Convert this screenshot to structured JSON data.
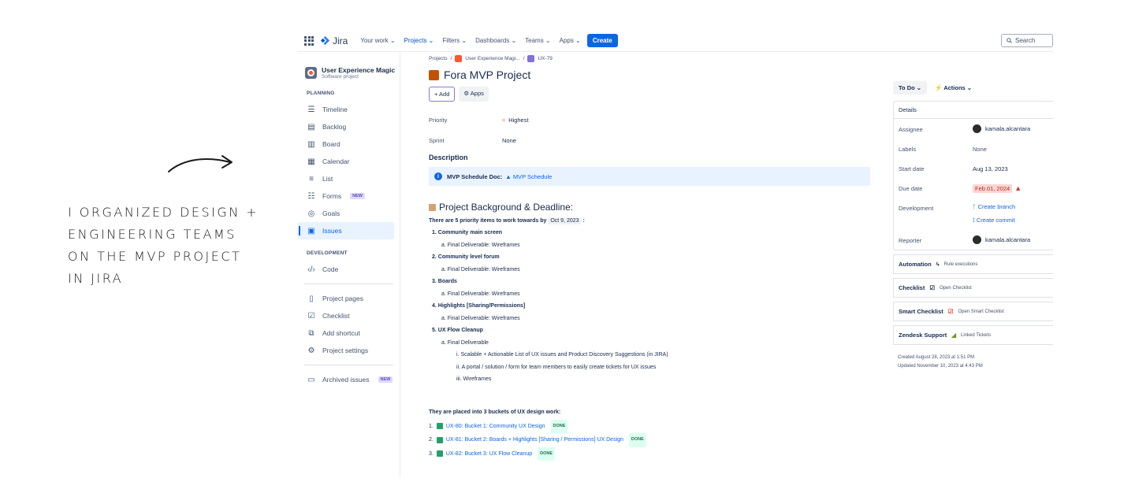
{
  "annotation": {
    "lines": [
      "I ORGANIZED DESIGN +",
      "ENGINEERING TEAMS",
      "ON THE MVP PROJECT",
      "IN JIRA"
    ]
  },
  "topnav": {
    "logo": "Jira",
    "items": [
      "Your work ⌄",
      "Projects ⌄",
      "Filters ⌄",
      "Dashboards ⌄",
      "Teams ⌄",
      "Apps ⌄"
    ],
    "create": "Create",
    "search_placeholder": "Search"
  },
  "sidebar": {
    "project_name": "User Experience Magic",
    "project_type": "Software project",
    "planning_label": "PLANNING",
    "planning": [
      {
        "label": "Timeline",
        "icon": "timeline-icon"
      },
      {
        "label": "Backlog",
        "icon": "backlog-icon"
      },
      {
        "label": "Board",
        "icon": "board-icon"
      },
      {
        "label": "Calendar",
        "icon": "calendar-icon"
      },
      {
        "label": "List",
        "icon": "list-icon"
      },
      {
        "label": "Forms",
        "icon": "forms-icon",
        "badge": "NEW"
      },
      {
        "label": "Goals",
        "icon": "goals-icon"
      },
      {
        "label": "Issues",
        "icon": "issues-icon"
      }
    ],
    "development_label": "DEVELOPMENT",
    "code": "Code",
    "project_pages": "Project pages",
    "checklist": "Checklist",
    "add_shortcut": "Add shortcut",
    "project_settings": "Project settings",
    "archived": "Archived issues",
    "archived_badge": "NEW"
  },
  "breadcrumb": {
    "projects": "Projects",
    "sep": "/",
    "project": "User Experience Magi...",
    "issue": "UX-79"
  },
  "issue": {
    "title": "Fora MVP Project",
    "add": "+ Add",
    "apps": "⚙ Apps",
    "priority_label": "Priority",
    "priority_value": "Highest",
    "sprint_label": "Sprint",
    "sprint_value": "None",
    "description_label": "Description",
    "panel_label": "MVP Schedule Doc:",
    "panel_link": "MVP Schedule",
    "bg_heading": "Project Background & Deadline:",
    "intro": "There are 5 priority items to work towards by",
    "intro_date": "Oct 9, 2023",
    "intro_end": ":",
    "items": [
      "1. Community main screen",
      "a. Final Deliverable: Wireframes",
      "2. Community level forum",
      "a. Final Deliverable: Wireframes",
      "3. Boards",
      "a. Final Deliverable: Wireframes",
      "4. Highlights [Sharing/Permissions]",
      "a. Final Deliverable: Wireframes",
      "5. UX Flow Cleanup",
      "a. Final Deliverable",
      "i. Scalable + Actionable List of UX issues and Product Discovery Suggestions (in JIRA)",
      "ii. A portal / solution / form for team members to easily create tickets for UX issues",
      "iii. Wireframes"
    ],
    "buckets_heading": "They are placed into 3 buckets of UX design work:",
    "buckets": [
      {
        "num": "1.",
        "link": "UX-80: Bucket 1: Community UX Design",
        "status": "DONE"
      },
      {
        "num": "2.",
        "link": "UX-81: Bucket 2: Boards + Highlights [Sharing / Permissions] UX Design",
        "status": "DONE"
      },
      {
        "num": "3.",
        "link": "UX-82: Bucket 3: UX Flow Cleanup",
        "status": "DONE"
      }
    ]
  },
  "details": {
    "status": "To Do ⌄",
    "actions": "Actions ⌄",
    "header": "Details",
    "assignee_label": "Assignee",
    "assignee": "kamala.alcantara",
    "labels_label": "Labels",
    "labels": "None",
    "start_label": "Start date",
    "start": "Aug 13, 2023",
    "due_label": "Due date",
    "due": "Feb 01, 2024",
    "dev_label": "Development",
    "create_branch": "Create branch",
    "create_commit": "Create commit",
    "reporter_label": "Reporter",
    "reporter": "kamala.alcantara",
    "automation": "Automation",
    "automation_sub": "Rule executions",
    "checklist": "Checklist",
    "checklist_sub": "Open Checklist",
    "smart": "Smart Checklist",
    "smart_sub": "Open Smart Checklist",
    "zendesk": "Zendesk Support",
    "zendesk_sub": "Linked Tickets",
    "created": "Created August 28, 2023 at 1:51 PM",
    "updated": "Updated November 10, 2023 at 4:43 PM"
  },
  "colors": {
    "accent": "#0c66e4",
    "done": "#216e4e",
    "danger": "#ae2e24"
  }
}
